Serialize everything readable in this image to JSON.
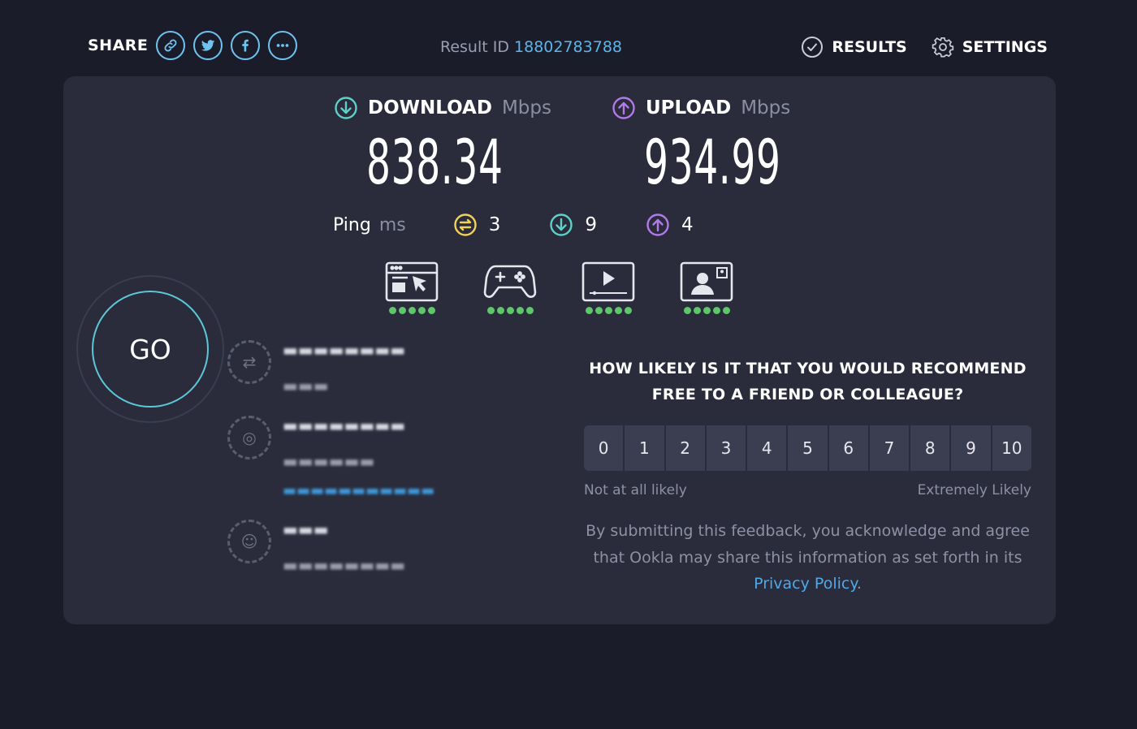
{
  "header": {
    "share_label": "SHARE",
    "share_buttons": [
      "link-icon",
      "twitter-icon",
      "facebook-icon",
      "more-icon"
    ],
    "result_id_label": "Result ID",
    "result_id": "18802783788",
    "results_label": "RESULTS",
    "settings_label": "SETTINGS"
  },
  "download": {
    "label": "DOWNLOAD",
    "unit": "Mbps",
    "value": "838.34",
    "color": "#5ed0c8"
  },
  "upload": {
    "label": "UPLOAD",
    "unit": "Mbps",
    "value": "934.99",
    "color": "#b27ae8"
  },
  "ping": {
    "label": "Ping",
    "unit": "ms",
    "idle": "3",
    "download": "9",
    "upload": "4",
    "idle_color": "#f1d35a"
  },
  "quality": [
    {
      "icon": "browsing-icon",
      "rating": 5
    },
    {
      "icon": "gaming-icon",
      "rating": 5
    },
    {
      "icon": "streaming-icon",
      "rating": 5
    },
    {
      "icon": "video-call-icon",
      "rating": 5
    }
  ],
  "go_label": "GO",
  "nps": {
    "question": "HOW LIKELY IS IT THAT YOU WOULD RECOMMEND FREE TO A FRIEND OR COLLEAGUE?",
    "scale": [
      "0",
      "1",
      "2",
      "3",
      "4",
      "5",
      "6",
      "7",
      "8",
      "9",
      "10"
    ],
    "low_label": "Not at all likely",
    "high_label": "Extremely Likely",
    "legal_prefix": "By submitting this feedback, you acknowledge and agree that Ookla may share this information as set forth in its ",
    "legal_link": "Privacy Policy",
    "legal_suffix": "."
  }
}
